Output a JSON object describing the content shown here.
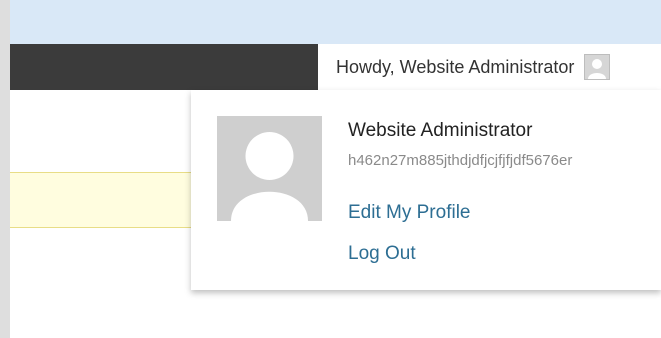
{
  "admin_bar": {
    "greeting": "Howdy, Website Administrator",
    "avatar_icon": "user-avatar-icon"
  },
  "user_menu": {
    "display_name": "Website Administrator",
    "username": "h462n27m885jthdjdfjcjfjfjdf5676er",
    "edit_profile_label": "Edit My Profile",
    "logout_label": "Log Out",
    "avatar_icon": "user-avatar-icon"
  },
  "colors": {
    "admin_bar_bg": "#3b3b3b",
    "top_strip_bg": "#d9e8f7",
    "link": "#2d6e93",
    "notice_bg": "#fffddf",
    "notice_border": "#e8dd86"
  }
}
